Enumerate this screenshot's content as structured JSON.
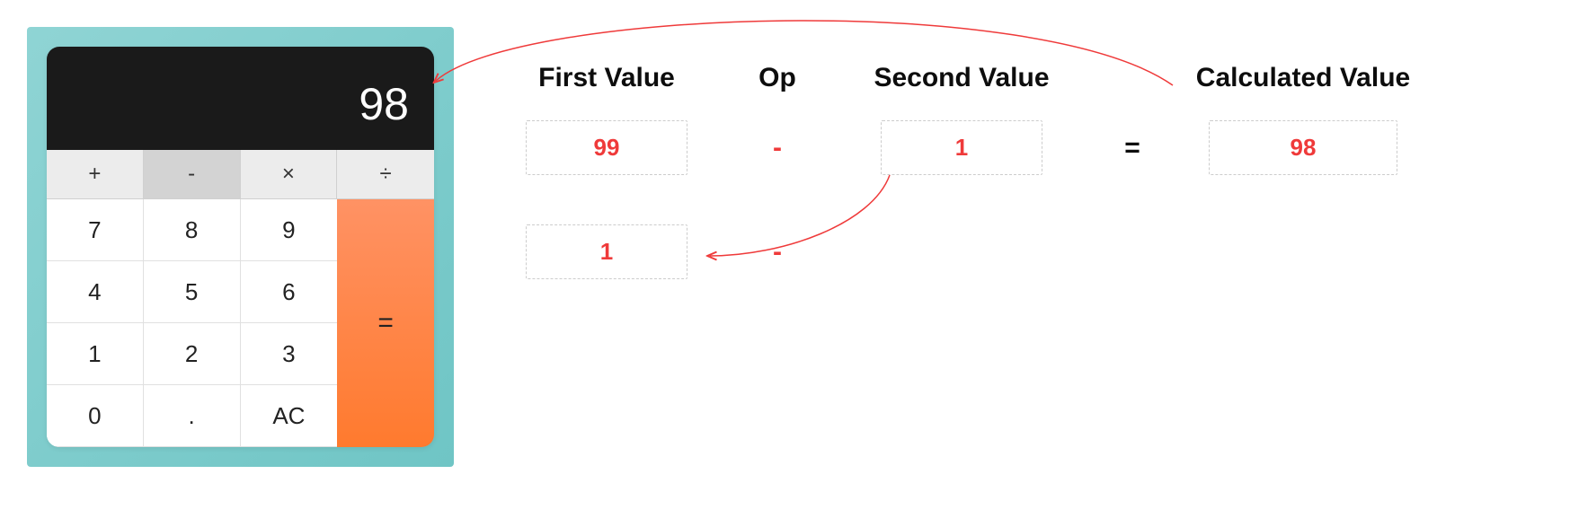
{
  "calculator": {
    "display": "98",
    "ops": {
      "plus": "+",
      "minus": "-",
      "multiply": "×",
      "divide": "÷",
      "active": "minus"
    },
    "keys": {
      "k7": "7",
      "k8": "8",
      "k9": "9",
      "k4": "4",
      "k5": "5",
      "k6": "6",
      "k1": "1",
      "k2": "2",
      "k3": "3",
      "k0": "0",
      "dot": ".",
      "ac": "AC"
    },
    "equals": "="
  },
  "explainer": {
    "headers": {
      "first": "First Value",
      "op": "Op",
      "second": "Second Value",
      "calc": "Calculated Value"
    },
    "eq_sign": "=",
    "row1": {
      "first": "99",
      "op": "-",
      "second": "1",
      "calc": "98"
    },
    "row2": {
      "first": "1",
      "op": "-"
    }
  }
}
